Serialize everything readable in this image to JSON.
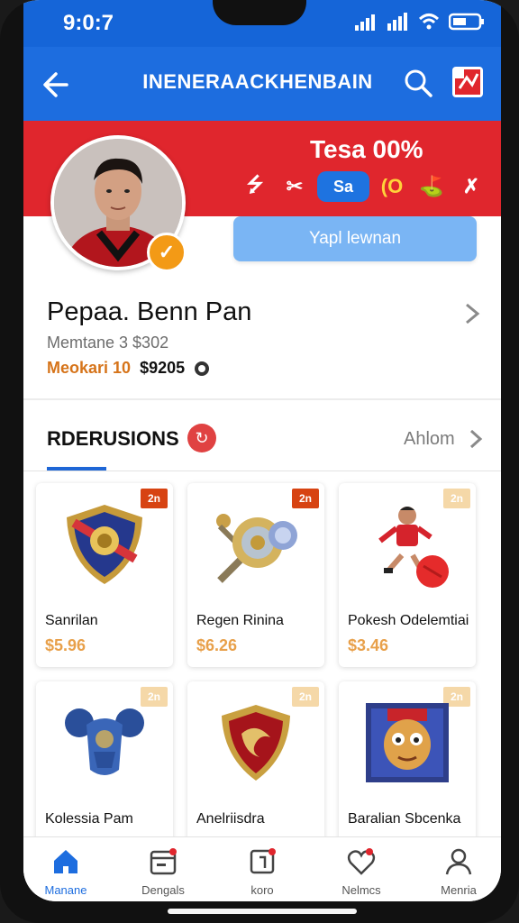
{
  "status": {
    "time": "9:0:7"
  },
  "appbar": {
    "title": "INENERAACKHENBAIN"
  },
  "profile": {
    "tesa": "Tesa 00%",
    "badges": [
      "⭍",
      "✂",
      "Sa",
      "(O",
      "⛳",
      "✗"
    ],
    "action_button": "Yapl lewnan",
    "name": "Pepaa. Benn Pan",
    "subtitle": "Memtane 3 $302",
    "meta_label": "Meokari 10",
    "meta_value": "$9205"
  },
  "section": {
    "title": "RDERUSIONS",
    "see_all": "Ahlom"
  },
  "cards": [
    {
      "tag": "2n",
      "name": "Sanrilan",
      "price": "$5.96",
      "icon": "shield-crest-icon"
    },
    {
      "tag": "2n",
      "name": "Regen Rinina",
      "price": "$6.26",
      "icon": "shield-mace-icon"
    },
    {
      "tag": "2n",
      "name": "Pokesh Odelemtiai",
      "price": "$3.46",
      "icon": "footballer-icon"
    },
    {
      "tag": "2n",
      "name": "Kolessia Pam",
      "price": "",
      "icon": "blue-armor-icon"
    },
    {
      "tag": "2n",
      "name": "Anelriisdra",
      "price": "",
      "icon": "red-shield-icon"
    },
    {
      "tag": "2n",
      "name": "Baralian Sbcenka",
      "price": "",
      "icon": "character-portrait-icon"
    }
  ],
  "nav": [
    {
      "label": "Manane",
      "icon": "home-icon"
    },
    {
      "label": "Dengals",
      "icon": "calendar-icon"
    },
    {
      "label": "koro",
      "icon": "bookmark-icon"
    },
    {
      "label": "Nelmcs",
      "icon": "heart-icon"
    },
    {
      "label": "Menria",
      "icon": "user-icon"
    }
  ]
}
